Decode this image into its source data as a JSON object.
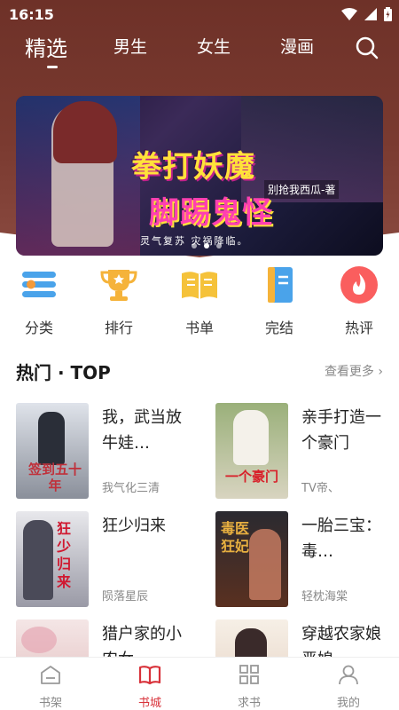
{
  "status_bar": {
    "time": "16:15"
  },
  "top_nav": {
    "tabs": [
      {
        "label": "精选",
        "active": true
      },
      {
        "label": "男生"
      },
      {
        "label": "女生"
      },
      {
        "label": "漫画"
      }
    ]
  },
  "banner": {
    "title_line1": "拳打妖魔",
    "title_line2": "脚踢鬼怪",
    "author_tag": "别抢我西瓜-著",
    "tagline": "灵气复苏  灾祸降临。",
    "slide_count": 3,
    "active_slide": 2
  },
  "categories": [
    {
      "label": "分类",
      "icon": "list-icon"
    },
    {
      "label": "排行",
      "icon": "trophy-icon"
    },
    {
      "label": "书单",
      "icon": "book-open-icon"
    },
    {
      "label": "完结",
      "icon": "book-icon"
    },
    {
      "label": "热评",
      "icon": "fire-icon"
    }
  ],
  "section": {
    "title": "热门 · TOP",
    "more": "查看更多"
  },
  "books": [
    {
      "name": "我，武当放牛娃…",
      "author": "我气化三清",
      "cover_title": "签到五十年",
      "cover_colors": [
        "#dfe3ea",
        "#8a8f9a"
      ],
      "cover_accent": "#c0303a"
    },
    {
      "name": "亲手打造一个豪门",
      "author": "TV帝、",
      "cover_title": "一个豪门",
      "cover_colors": [
        "#9ab07a",
        "#d8d4c0"
      ],
      "cover_accent": "#d8202a"
    },
    {
      "name": "狂少归来",
      "author": "陨落星辰",
      "cover_title": "狂少归来",
      "cover_colors": [
        "#e8e8ec",
        "#9a9aa6"
      ],
      "cover_accent": "#d01830"
    },
    {
      "name": "一胎三宝：毒…",
      "author": "轻枕海棠",
      "cover_title": "毒医狂妃",
      "cover_colors": [
        "#2a2a30",
        "#5a3020"
      ],
      "cover_accent": "#e8b040"
    },
    {
      "name": "猎户家的小农女",
      "author": "",
      "cover_title": "",
      "cover_colors": [
        "#f4e6e6",
        "#e0b8b8"
      ],
      "cover_accent": "#b83040"
    },
    {
      "name": "穿越农家娘恶媳",
      "author": "",
      "cover_title": "",
      "cover_colors": [
        "#f6efe6",
        "#e4cfc0"
      ],
      "cover_accent": "#c03040"
    }
  ],
  "bottom_tabs": [
    {
      "label": "书架",
      "icon": "bookshelf-icon"
    },
    {
      "label": "书城",
      "icon": "bookstore-icon",
      "active": true
    },
    {
      "label": "求书",
      "icon": "grid-icon"
    },
    {
      "label": "我的",
      "icon": "user-icon"
    }
  ],
  "colors": {
    "header": "#6e3128",
    "accent": "#d8323a"
  }
}
